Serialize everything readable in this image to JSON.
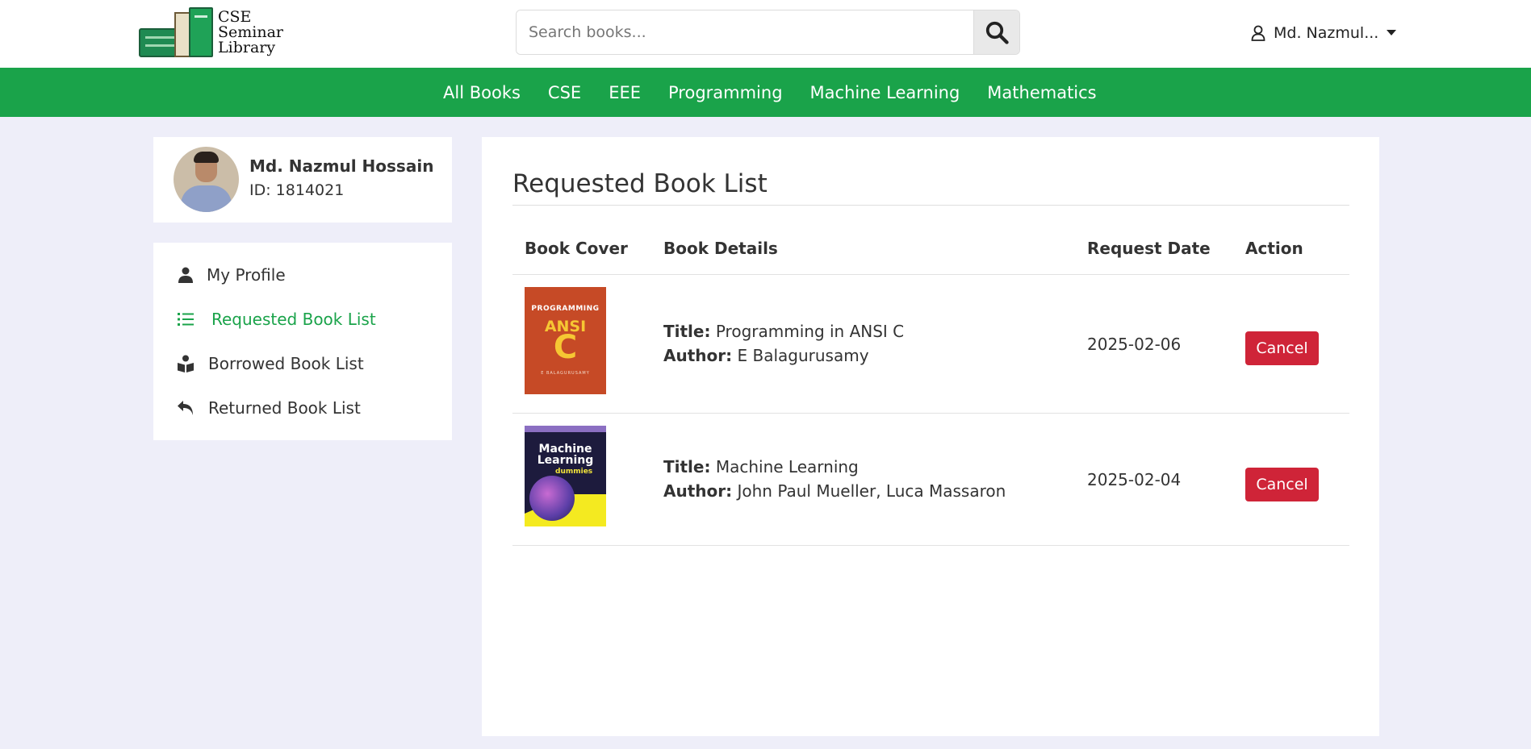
{
  "header": {
    "logo_lines": [
      "CSE",
      "Seminar",
      "Library"
    ],
    "search_placeholder": "Search books...",
    "search_icon": "search-icon",
    "user_label": "Md. Nazmul...",
    "user_icon": "user-icon",
    "dropdown_icon": "caret-down-icon"
  },
  "nav": {
    "items": [
      "All Books",
      "CSE",
      "EEE",
      "Programming",
      "Machine Learning",
      "Mathematics"
    ]
  },
  "profile": {
    "name": "Md. Nazmul Hossain",
    "id_text": "ID: 1814021"
  },
  "sidebar": {
    "items": [
      {
        "label": "My Profile",
        "icon": "user-icon",
        "active": false
      },
      {
        "label": "Requested Book List",
        "icon": "list-icon",
        "active": true
      },
      {
        "label": "Borrowed Book List",
        "icon": "book-reader-icon",
        "active": false
      },
      {
        "label": "Returned Book List",
        "icon": "reply-icon",
        "active": false
      }
    ]
  },
  "main": {
    "title": "Requested Book List",
    "columns": [
      "Book Cover",
      "Book Details",
      "Request Date",
      "Action"
    ],
    "rows": [
      {
        "cover_lines": [
          "PROGRAMMING",
          "ANSI",
          "C",
          "E BALAGURUSAMY"
        ],
        "title_label": "Title:",
        "title": "Programming in ANSI C",
        "author_label": "Author:",
        "author": "E Balagurusamy",
        "date": "2025-02-06",
        "action": "Cancel"
      },
      {
        "cover_lines": [
          "Machine",
          "Learning",
          "dummies"
        ],
        "title_label": "Title:",
        "title": "Machine Learning",
        "author_label": "Author:",
        "author": "John Paul Mueller, Luca Massaron",
        "date": "2025-02-04",
        "action": "Cancel"
      }
    ]
  },
  "colors": {
    "brand_green": "#1aa34a",
    "cancel_red": "#cf2438",
    "page_bg": "#eeeef9"
  }
}
